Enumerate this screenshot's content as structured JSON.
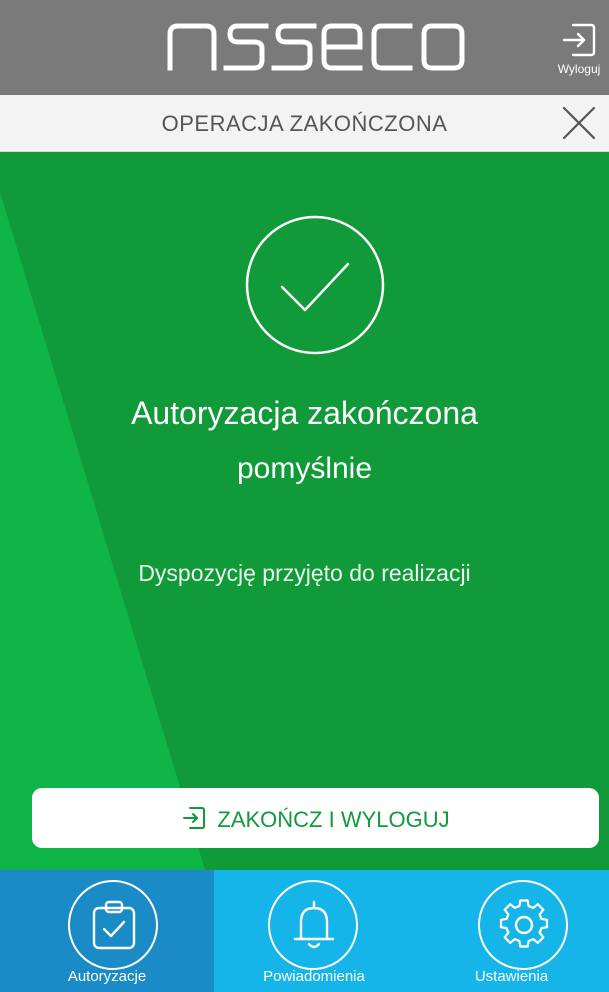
{
  "header": {
    "brand": "asseco",
    "logout_label": "Wyloguj"
  },
  "titlebar": {
    "title": "OPERACJA ZAKOŃCZONA"
  },
  "main": {
    "headline": "Autoryzacja zakończona",
    "headline_strong": "pomyślnie",
    "subtext": "Dyspozycję przyjęto do realizacji",
    "button_label": "ZAKOŃCZ I WYLOGUJ"
  },
  "nav": {
    "items": [
      {
        "label": "Autoryzacje",
        "icon": "clipboard-check-icon",
        "active": true
      },
      {
        "label": "Powiadomienia",
        "icon": "bell-icon",
        "active": false
      },
      {
        "label": "Ustawienia",
        "icon": "gear-icon",
        "active": false
      }
    ]
  },
  "colors": {
    "header_bg": "#7a7a7a",
    "titlebar_bg": "#f3f3f3",
    "success_green": "#119a3a",
    "nav_blue": "#16b5e9",
    "nav_active_blue": "#1a8bc6"
  }
}
